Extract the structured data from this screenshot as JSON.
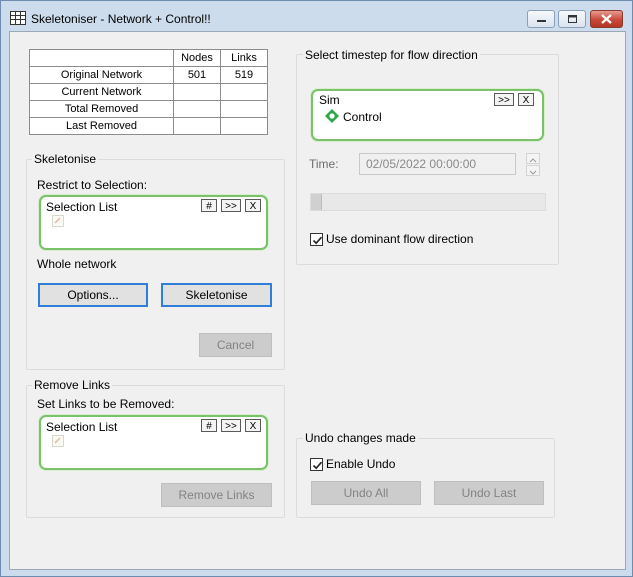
{
  "window": {
    "title": "Skeletoniser - Network + Control!!"
  },
  "stats": {
    "headers": [
      "Nodes",
      "Links"
    ],
    "rows": [
      {
        "label": "Original Network",
        "nodes": "501",
        "links": "519"
      },
      {
        "label": "Current Network",
        "nodes": "",
        "links": ""
      },
      {
        "label": "Total Removed",
        "nodes": "",
        "links": ""
      },
      {
        "label": "Last Removed",
        "nodes": "",
        "links": ""
      }
    ]
  },
  "skeletonise": {
    "group_label": "Skeletonise",
    "restrict_label": "Restrict to Selection:",
    "selection_title": "Selection List",
    "hash": "#",
    "more": ">>",
    "clear": "X",
    "whole_network": "Whole network",
    "options_button": "Options...",
    "skeletonise_button": "Skeletonise",
    "cancel_button": "Cancel"
  },
  "remove_links": {
    "group_label": "Remove Links",
    "set_label": "Set Links to be Removed:",
    "selection_title": "Selection List",
    "hash": "#",
    "more": ">>",
    "clear": "X",
    "remove_button": "Remove Links"
  },
  "flow": {
    "group_label": "Select timestep for flow direction",
    "sim_title": "Sim",
    "more": ">>",
    "clear": "X",
    "sim_item": "Control",
    "time_label": "Time:",
    "time_value": "02/05/2022 00:00:00",
    "slider_position": 0,
    "dominant_label": "Use dominant flow direction",
    "dominant_checked": true
  },
  "undo": {
    "group_label": "Undo changes made",
    "enable_label": "Enable Undo",
    "enable_checked": true,
    "undo_all_button": "Undo All",
    "undo_last_button": "Undo Last"
  },
  "colors": {
    "accent": "#2f7ed8",
    "selection_border": "#7bc06b",
    "sim_icon": "#2fa64a"
  }
}
